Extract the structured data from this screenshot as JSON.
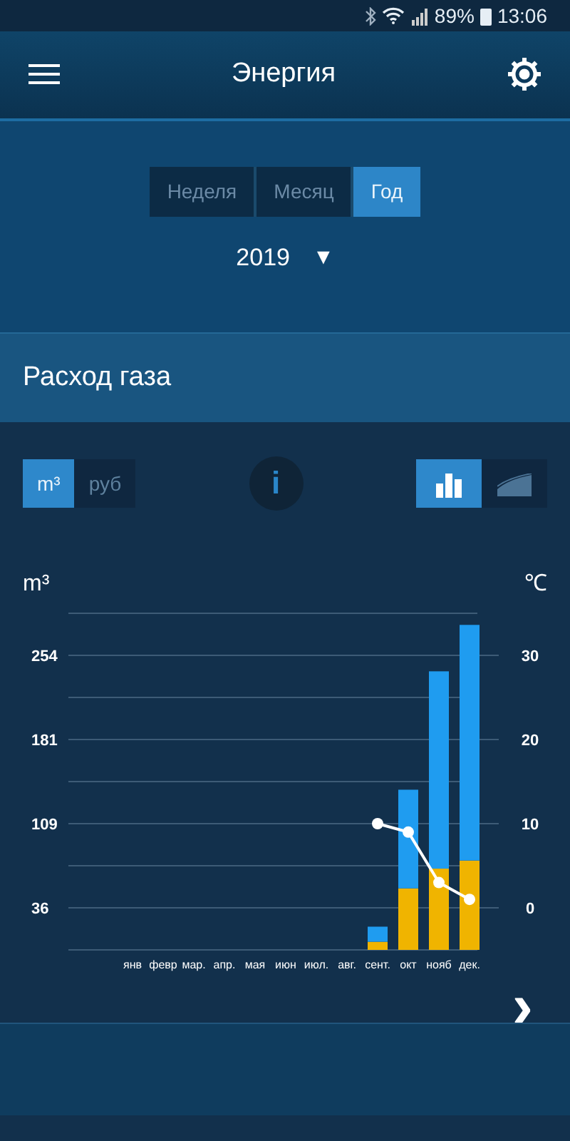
{
  "status_bar": {
    "battery": "89%",
    "time": "13:06"
  },
  "header": {
    "title": "Энергия"
  },
  "period_tabs": [
    {
      "label": "Неделя",
      "selected": false
    },
    {
      "label": "Месяц",
      "selected": false
    },
    {
      "label": "Год",
      "selected": true
    }
  ],
  "year_picker": {
    "value": "2019",
    "arrow": "▼"
  },
  "section": {
    "title": "Расход газа"
  },
  "unit_toggle": [
    {
      "label": "m³",
      "selected": true
    },
    {
      "label": "руб",
      "selected": false
    }
  ],
  "view_toggle": [
    {
      "kind": "bars",
      "selected": true
    },
    {
      "kind": "area",
      "selected": false
    }
  ],
  "info_button": {
    "label": "i"
  },
  "chart": {
    "left_unit": "m³",
    "right_unit": "℃",
    "next_arrow": "›",
    "chart_data": {
      "type": "bar",
      "stacked": true,
      "categories": [
        "янв",
        "февр",
        "мар.",
        "апр.",
        "мая",
        "июн",
        "июл.",
        "авг.",
        "сент.",
        "окт",
        "нояб",
        "дек."
      ],
      "grid": true,
      "ylim": [
        0,
        290
      ],
      "yticks": [
        36,
        109,
        181,
        254
      ],
      "y2lim": [
        -5,
        35
      ],
      "y2ticks": [
        0,
        10,
        20,
        30
      ],
      "series": [
        {
          "color": "#f0b400",
          "values": [
            null,
            null,
            null,
            null,
            null,
            null,
            null,
            null,
            7,
            53,
            70,
            77
          ]
        },
        {
          "color": "#1f9cf0",
          "values": [
            null,
            null,
            null,
            null,
            null,
            null,
            null,
            null,
            13,
            85,
            170,
            203
          ]
        },
        {
          "color": "#ffffff",
          "axis": "y2",
          "type": "line",
          "marker": "circle",
          "values": [
            null,
            null,
            null,
            null,
            null,
            null,
            null,
            null,
            10,
            9,
            3,
            1
          ]
        }
      ]
    }
  }
}
